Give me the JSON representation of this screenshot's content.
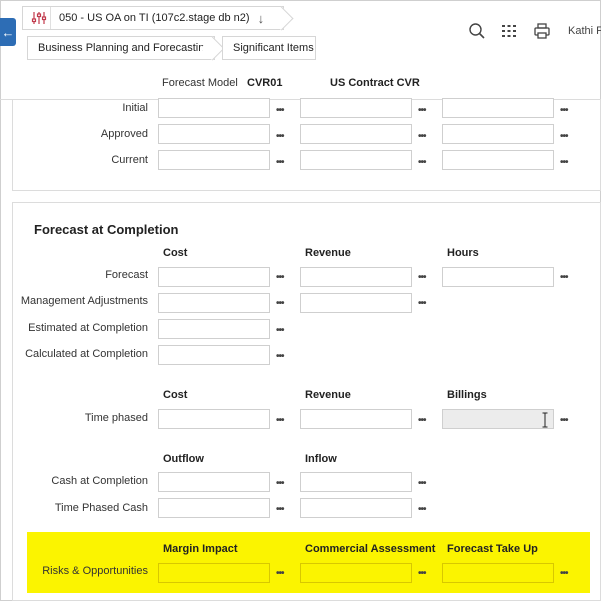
{
  "header": {
    "record_title": "050 - US OA on TI (107c2.stage db n2)",
    "breadcrumbs": [
      "Business Planning and Forecasting",
      "Significant Items"
    ],
    "user_name": "Kathi F"
  },
  "model": {
    "label": "Forecast Model",
    "code": "CVR01",
    "name": "US Contract CVR"
  },
  "top_section": {
    "rows": [
      "Initial",
      "Approved",
      "Current"
    ]
  },
  "fac": {
    "title": "Forecast at Completion",
    "columns": [
      "Cost",
      "Revenue",
      "Hours"
    ],
    "rows": [
      "Forecast",
      "Management Adjustments",
      "Estimated at Completion",
      "Calculated at Completion"
    ]
  },
  "time_phased": {
    "columns": [
      "Cost",
      "Revenue",
      "Billings"
    ],
    "row": "Time phased"
  },
  "cash": {
    "columns": [
      "Outflow",
      "Inflow"
    ],
    "rows": [
      "Cash at Completion",
      "Time Phased Cash"
    ]
  },
  "risks": {
    "columns": [
      "Margin Impact",
      "Commercial Assessment",
      "Forecast Take Up"
    ],
    "row": "Risks & Opportunities"
  },
  "ui": {
    "more_glyph": "•••",
    "back_glyph": "←",
    "down_glyph": "↓"
  },
  "colors": {
    "accent": "#2d6db5",
    "highlight": "#fbf400"
  }
}
